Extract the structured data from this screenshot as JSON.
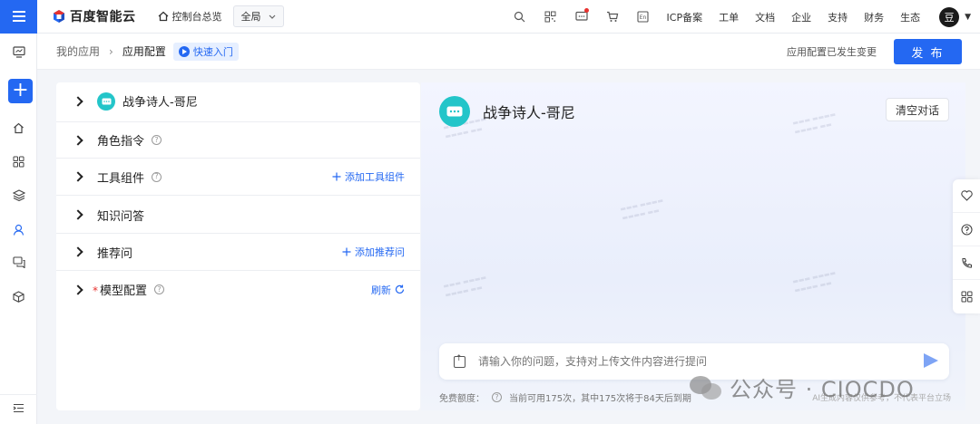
{
  "topbar": {
    "brand": "百度智能云",
    "console_label": "控制台总览",
    "region": "全局",
    "links": [
      "ICP备案",
      "工单",
      "文档",
      "企业",
      "支持",
      "财务",
      "生态"
    ],
    "icons": [
      "search-icon",
      "qrcode-icon",
      "message-icon",
      "cart-icon",
      "language-icon"
    ],
    "avatar_text": "豆"
  },
  "leftrail": {
    "items": [
      "monitor-icon",
      "add-icon",
      "home-icon",
      "apps-icon",
      "layers-icon",
      "user-icon",
      "chat-icon",
      "cube-icon",
      "collapse-icon"
    ]
  },
  "breadcrumb": {
    "parent": "我的应用",
    "current": "应用配置",
    "quickstart": "快速入门",
    "status": "应用配置已发生变更",
    "publish": "发 布"
  },
  "config": {
    "app_name": "战争诗人-哥尼",
    "rows": [
      {
        "label": "角色指令"
      },
      {
        "label": "工具组件",
        "action": "添加工具组件"
      },
      {
        "label": "知识问答"
      },
      {
        "label": "推荐问",
        "action": "添加推荐问"
      },
      {
        "label": "模型配置",
        "action": "刷新"
      }
    ]
  },
  "chat": {
    "title": "战争诗人-哥尼",
    "clear": "清空对话",
    "placeholder": "请输入你的问题，支持对上传文件内容进行提问",
    "quota_label": "免费额度：",
    "quota_text": "当前可用175次，其中175次将于84天后到期",
    "disclaimer": "AI生成内容仅供参考，不代表平台立场"
  },
  "overlay": {
    "wechat": "公众号 · CIOCDO"
  },
  "colors": {
    "primary": "#2468f2",
    "bot": "#23c5c9"
  }
}
